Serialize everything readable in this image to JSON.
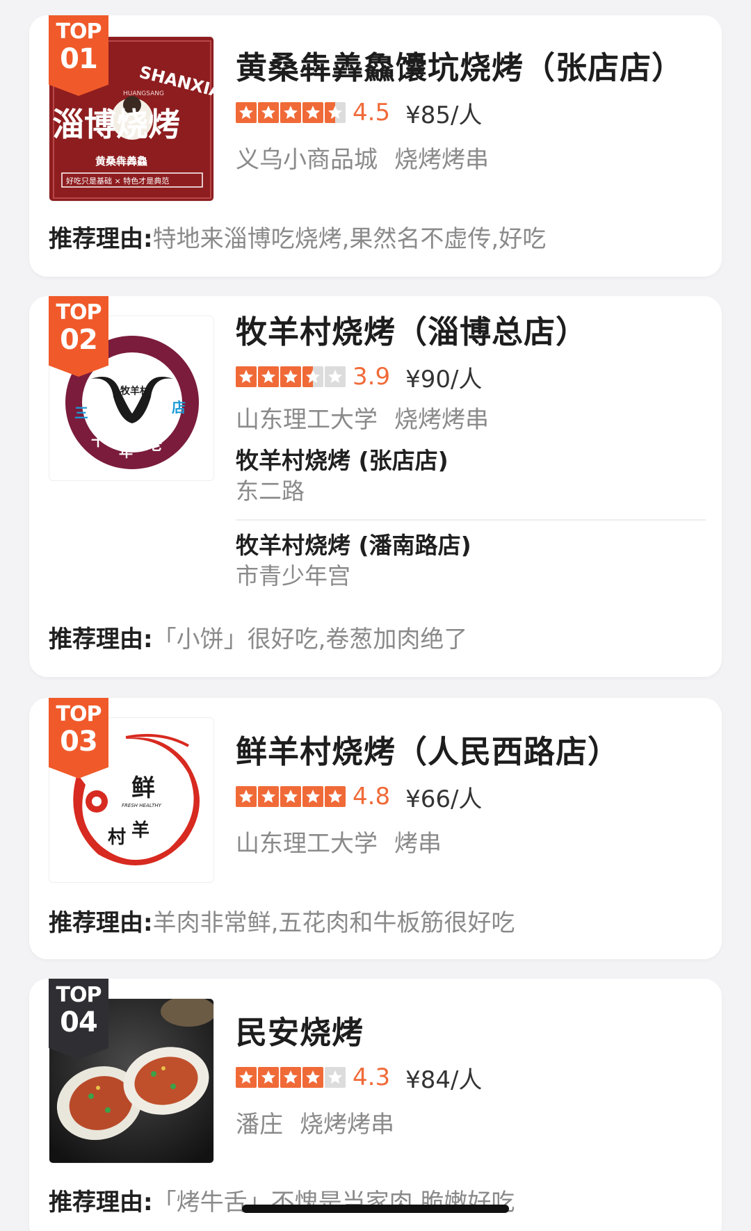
{
  "colors": {
    "accent": "#f05a2a",
    "star_on": "#f06a38",
    "star_off": "#dcdcdc",
    "muted_text": "#8a8a8a",
    "badge_dark": "#2f2f33"
  },
  "reason_label": "推荐理由:",
  "items": [
    {
      "rank_top": "TOP",
      "rank_num": "01",
      "name": "黄桑犇羴鱻馕坑烧烤（张店店）",
      "rating": 4.5,
      "score": "4.5",
      "price": "¥85/人",
      "area": "义乌小商品城",
      "category": "烧烤烤串",
      "reason": "特地来淄博吃烧烤,果然名不虚传,好吃",
      "logo": {
        "title": "淄博烧烤",
        "top_text": "SHANXIAN",
        "sub": "HUANGSANG",
        "cn": "黄桑犇羴鱻",
        "slogan": "好吃只是基础 × 特色才是典范"
      }
    },
    {
      "rank_top": "TOP",
      "rank_num": "02",
      "name": "牧羊村烧烤（淄博总店）",
      "rating": 3.5,
      "score": "3.9",
      "price": "¥90/人",
      "area": "山东理工大学",
      "category": "烧烤烤串",
      "branches": [
        {
          "name": "牧羊村烧烤 (张店店)",
          "address": "东二路"
        },
        {
          "name": "牧羊村烧烤 (潘南路店)",
          "address": "市青少年宫"
        }
      ],
      "reason": "「小饼」很好吃,卷葱加肉绝了",
      "logo": {
        "brand": "牧羊村",
        "ring": [
          "三",
          "十",
          "年",
          "老",
          "店"
        ]
      }
    },
    {
      "rank_top": "TOP",
      "rank_num": "03",
      "name": "鲜羊村烧烤（人民西路店）",
      "rating": 5,
      "score": "4.8",
      "price": "¥66/人",
      "area": "山东理工大学",
      "category": "烤串",
      "reason": "羊肉非常鲜,五花肉和牛板筋很好吃",
      "logo": {
        "c1": "鲜",
        "c2": "羊",
        "c3": "村",
        "en": "FRESH HEALTHY"
      }
    },
    {
      "rank_top": "TOP",
      "rank_num": "04",
      "name": "民安烧烤",
      "rating": 4,
      "score": "4.3",
      "price": "¥84/人",
      "area": "潘庄",
      "category": "烧烤烤串",
      "reason": "「烤牛舌」不愧是当家肉,脆嫩好吃"
    }
  ]
}
